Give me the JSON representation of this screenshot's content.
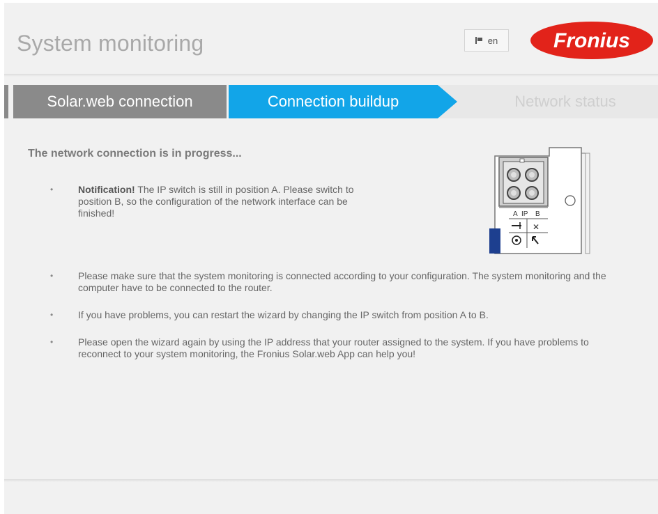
{
  "header": {
    "title": "System monitoring",
    "language": "en",
    "flag_icon": "flag-icon",
    "logo_text": "Fronius",
    "brand_color": "#e2231a"
  },
  "steps": [
    {
      "label": "Solar.web connection",
      "state": "done"
    },
    {
      "label": "Connection buildup",
      "state": "active"
    },
    {
      "label": "Network status",
      "state": "pending"
    }
  ],
  "colors": {
    "active_step": "#12a5e8",
    "done_step": "#8a8a8a",
    "pending_step": "#e8e8e8",
    "diagram_accent": "#1d3f8f"
  },
  "content": {
    "heading": "The network connection is in progress...",
    "notification_label": "Notification!",
    "notification_text": "The IP switch is still in position A. Please switch to position B, so the configuration of the network interface can be finished!",
    "bullets": [
      "Please make sure that the system monitoring is connected according to your configuration. The system monitoring and the computer have to be connected to the router.",
      "If you have problems, you can restart the wizard by changing the IP switch from position A to B.",
      "Please open the wizard again by using the IP address that your router assigned to the system. If you have problems to reconnect to your system monitoring, the Fronius Solar.web App can help you!"
    ],
    "bullet_symbol": "•"
  },
  "diagram": {
    "ip_label": "IP",
    "pos_a": "A",
    "pos_b": "B",
    "x_symbol": "✕"
  }
}
